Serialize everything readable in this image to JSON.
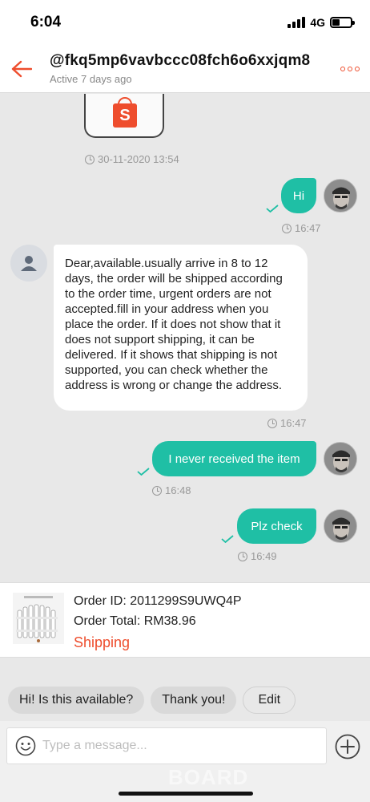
{
  "status_bar": {
    "time": "6:04",
    "network": "4G"
  },
  "header": {
    "title": "@fkq5mp6vavbccc08fch6o6xxjqm8",
    "subtitle": "Active 7 days ago"
  },
  "chat": {
    "bag_logo_letter": "S",
    "first_timestamp": "30-11-2020 13:54",
    "messages": [
      {
        "from": "me",
        "text": "Hi",
        "time": "16:47"
      },
      {
        "from": "shop",
        "text": "Dear,available.usually arrive in 8 to 12 days, the order will be shipped according to the order time, urgent orders are not accepted.fill in your address when you place the order. If it does not show that it does not support shipping, it can be delivered. If it shows that shipping is not supported, you can check whether the address is wrong or change the address.",
        "time": "16:47"
      },
      {
        "from": "me",
        "text": "I never received the item",
        "time": "16:48"
      },
      {
        "from": "me",
        "text": "Plz check",
        "time": "16:49"
      }
    ]
  },
  "order": {
    "id_line": "Order ID: 2011299S9UWQ4P",
    "total_line": "Order Total: RM38.96",
    "status": "Shipping"
  },
  "quick_replies": [
    "Hi! Is this available?",
    "Thank you!",
    "Edit"
  ],
  "composer": {
    "placeholder": "Type a message..."
  },
  "watermark": "BOARD",
  "colors": {
    "accent": "#ee4d2d",
    "bubble_out": "#1fbfa5",
    "check": "#1fbfa5"
  }
}
